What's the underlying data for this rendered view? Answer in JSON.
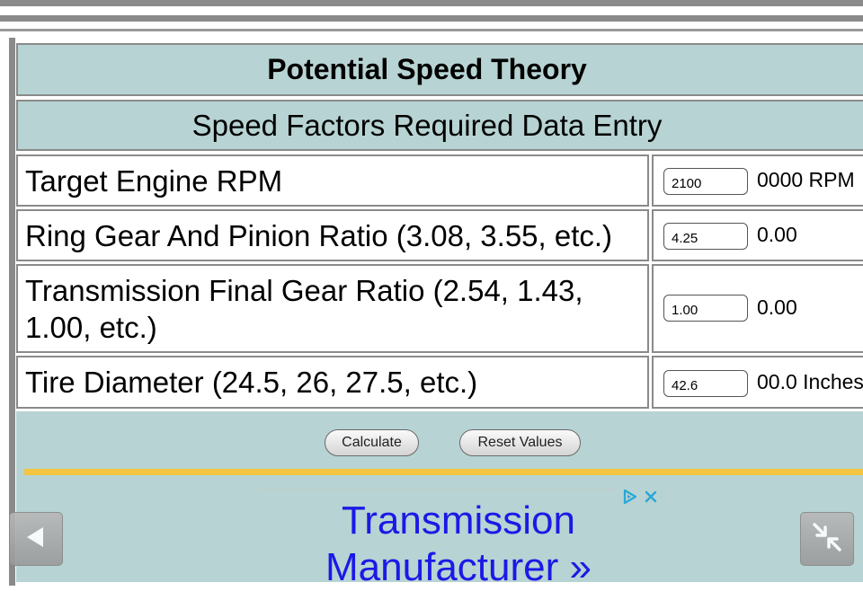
{
  "header": {
    "title": "Potential Speed Theory",
    "subtitle": "Speed Factors Required Data Entry"
  },
  "rows": [
    {
      "label": "Target Engine RPM",
      "value": "2100",
      "suffix": "0000 RPM"
    },
    {
      "label": "Ring Gear And Pinion Ratio (3.08, 3.55, etc.)",
      "value": "4.25",
      "suffix": "0.00"
    },
    {
      "label": "Transmission Final Gear Ratio (2.54, 1.43, 1.00, etc.)",
      "value": "1.00",
      "suffix": "0.00"
    },
    {
      "label": "Tire Diameter (24.5, 26, 27.5, etc.)",
      "value": "42.6",
      "suffix": "00.0 Inches"
    }
  ],
  "buttons": {
    "calculate": "Calculate",
    "reset": "Reset Values"
  },
  "ad": {
    "text": "Transmission Manufacturer »",
    "icons": [
      "adchoices-icon",
      "close-icon"
    ]
  },
  "nav": {
    "back_icon": "back-arrow-icon",
    "fullscreen_icon": "exit-fullscreen-icon"
  },
  "colors": {
    "panel_teal": "#b7d3d3",
    "border_gray": "#8a8a8a",
    "divider_yellow": "#f4c542",
    "ad_link_blue": "#1a1ae6"
  }
}
